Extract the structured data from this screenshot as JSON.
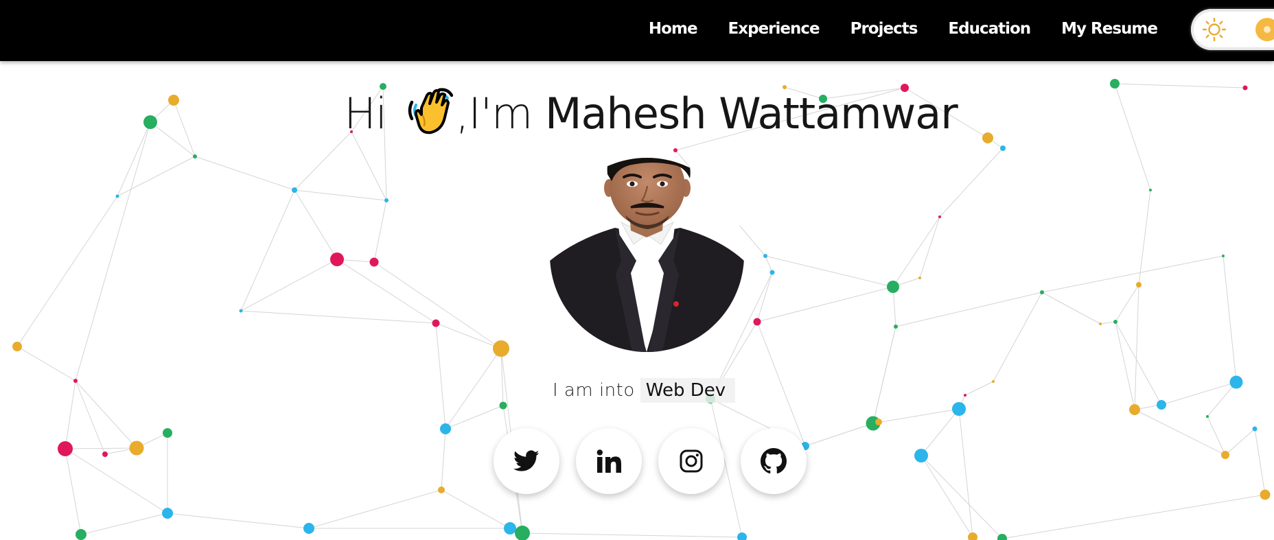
{
  "nav": {
    "links": [
      "Home",
      "Experience",
      "Projects",
      "Education",
      "My Resume"
    ],
    "theme_toggle": {
      "state": "light",
      "icon": "sun-icon"
    }
  },
  "hero": {
    "greeting_prefix": "Hi ",
    "wave_icon": "waving-hand-icon",
    "greeting_mid": ",I'm ",
    "name": "Mahesh Wattamwar",
    "tagline_lead": "I am into",
    "tagline_typed": "Web Dev"
  },
  "socials": [
    {
      "name": "Twitter",
      "icon": "twitter-icon"
    },
    {
      "name": "LinkedIn",
      "icon": "linkedin-icon"
    },
    {
      "name": "Instagram",
      "icon": "instagram-icon"
    },
    {
      "name": "GitHub",
      "icon": "github-icon"
    }
  ],
  "colors": {
    "navbar_bg": "#000000",
    "nav_text": "#ffffff",
    "accent_yellow": "#e8ab2c",
    "dot_green": "#27ae60",
    "dot_red": "#e0185a",
    "dot_blue": "#2bb5ea"
  }
}
